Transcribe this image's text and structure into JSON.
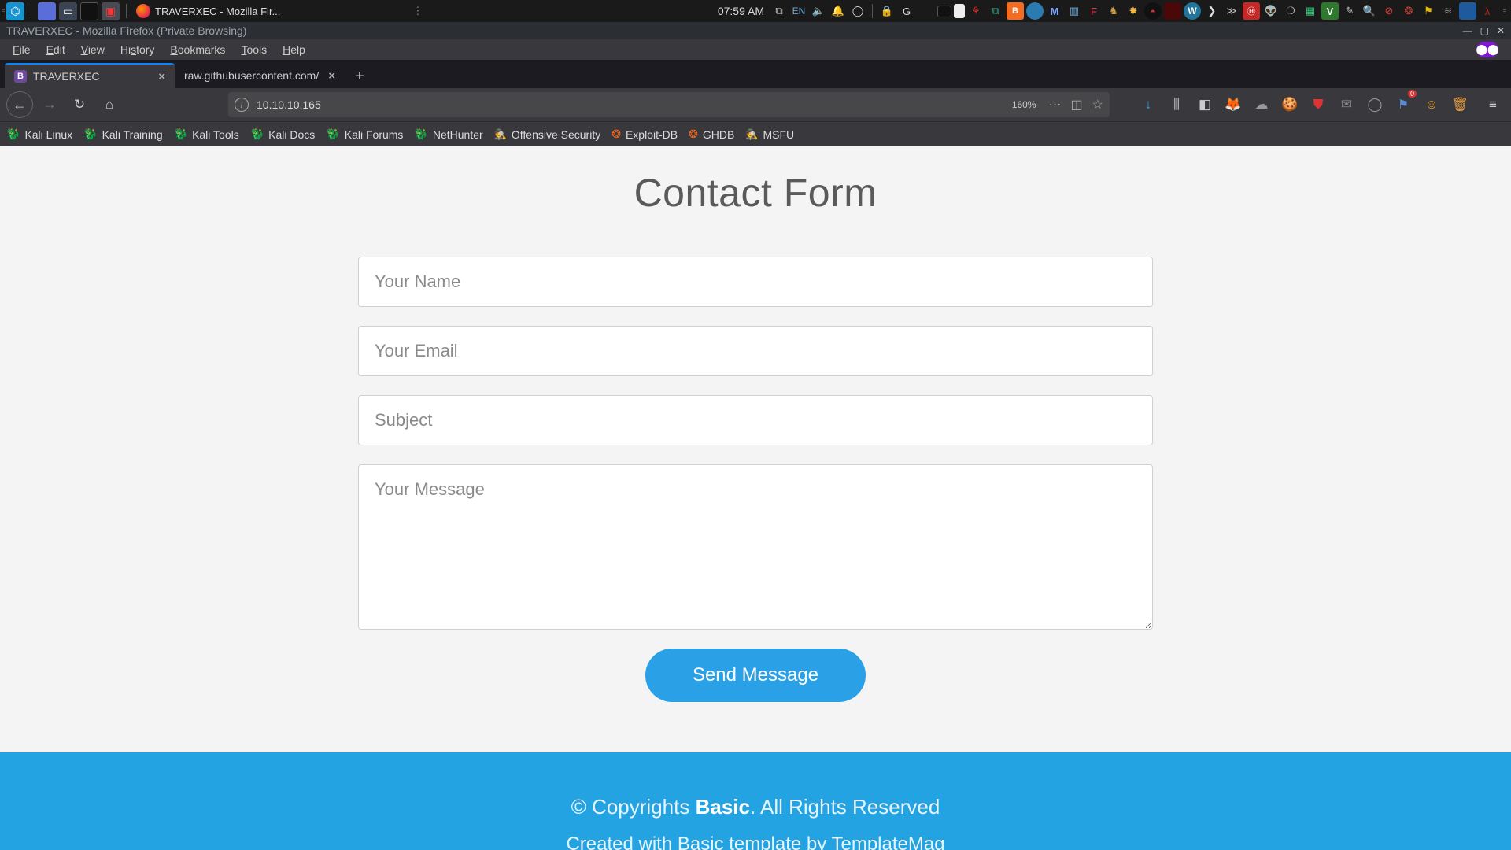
{
  "panel": {
    "task_title": "TRAVERXEC - Mozilla Fir...",
    "clock": "07:59 AM",
    "lang": "EN"
  },
  "window": {
    "title": "TRAVERXEC - Mozilla Firefox (Private Browsing)"
  },
  "menubar": {
    "items": [
      "File",
      "Edit",
      "View",
      "History",
      "Bookmarks",
      "Tools",
      "Help"
    ]
  },
  "tabs": [
    {
      "title": "TRAVERXEC",
      "favicon": "B",
      "active": true
    },
    {
      "title": "raw.githubusercontent.com/",
      "favicon": "",
      "active": false
    }
  ],
  "nav": {
    "url": "10.10.10.165",
    "zoom": "160%"
  },
  "bookmarks": [
    {
      "label": "Kali Linux",
      "icon": "dragon"
    },
    {
      "label": "Kali Training",
      "icon": "dragon"
    },
    {
      "label": "Kali Tools",
      "icon": "dragon"
    },
    {
      "label": "Kali Docs",
      "icon": "dragon"
    },
    {
      "label": "Kali Forums",
      "icon": "dragon"
    },
    {
      "label": "NetHunter",
      "icon": "dragon"
    },
    {
      "label": "Offensive Security",
      "icon": "hk"
    },
    {
      "label": "Exploit-DB",
      "icon": "db"
    },
    {
      "label": "GHDB",
      "icon": "db"
    },
    {
      "label": "MSFU",
      "icon": "hk"
    }
  ],
  "page": {
    "heading": "Contact Form",
    "placeholders": {
      "name": "Your Name",
      "email": "Your Email",
      "subject": "Subject",
      "message": "Your Message"
    },
    "send_label": "Send Message",
    "footer_prefix": "© Copyrights ",
    "footer_brand": "Basic",
    "footer_suffix": ". All Rights Reserved",
    "footer_line2": "Created with Basic template by TemplateMag"
  }
}
